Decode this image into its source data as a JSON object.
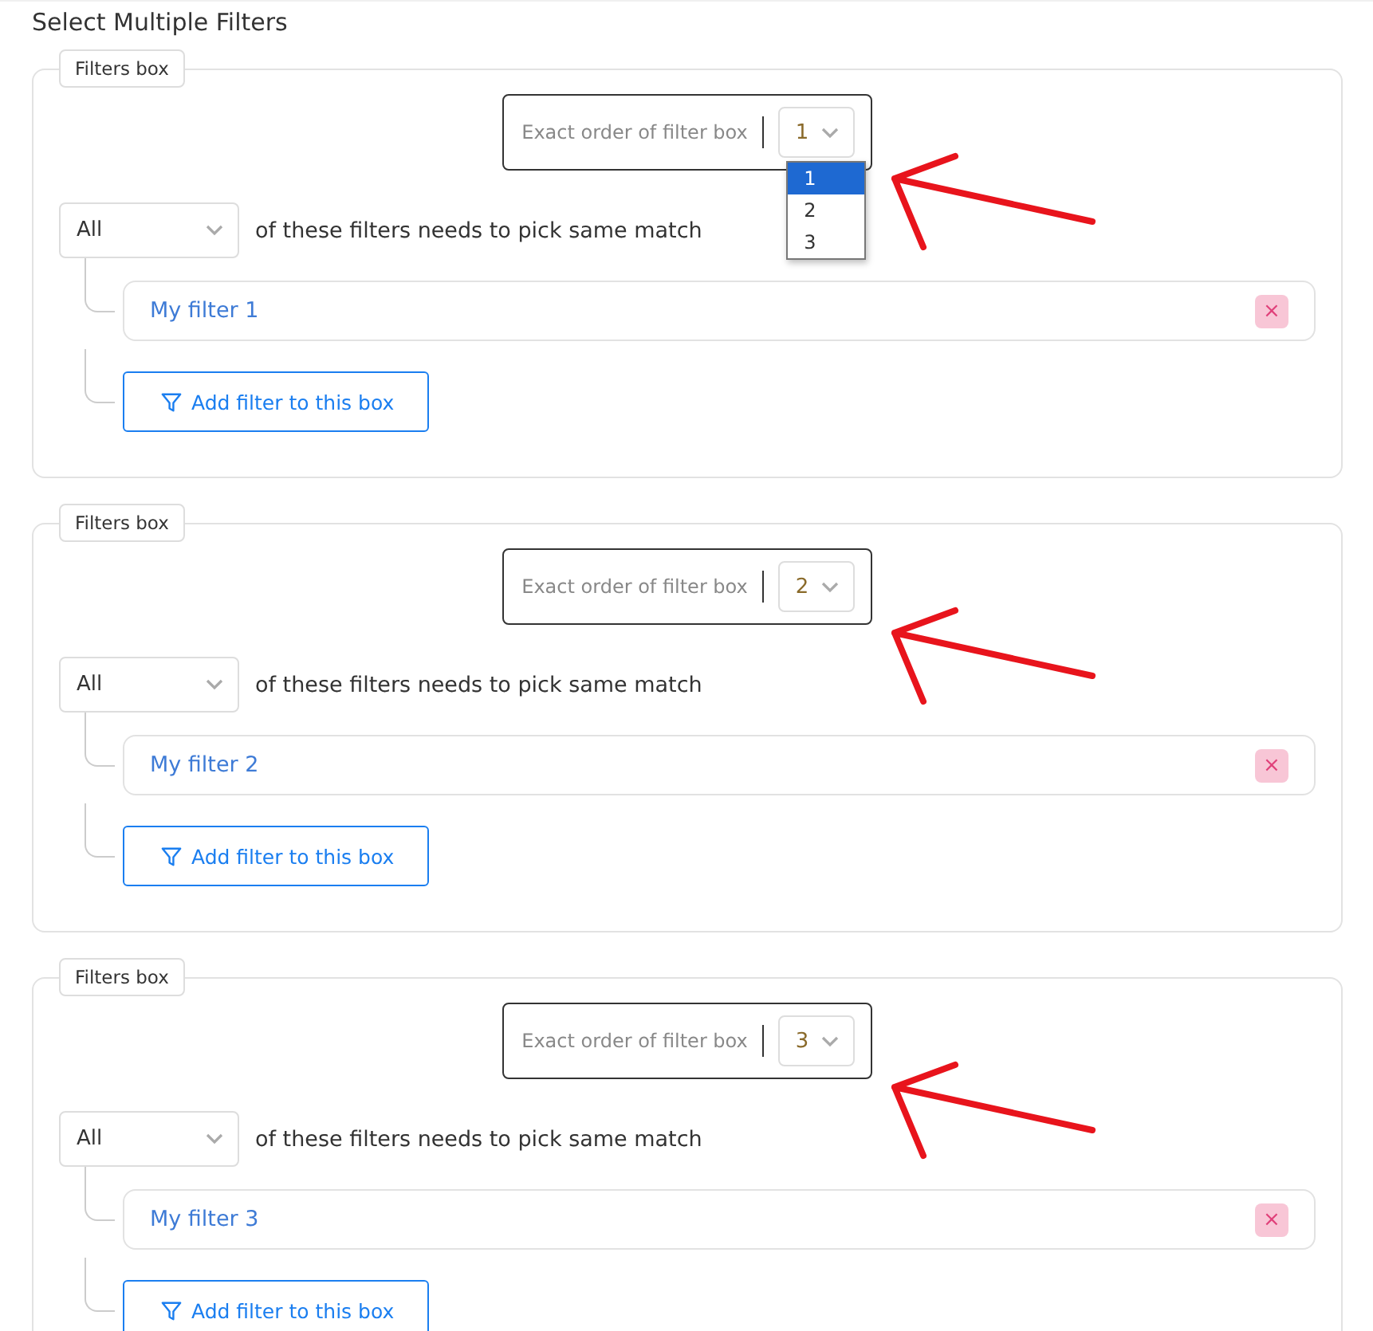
{
  "title": "Select Multiple Filters",
  "boxes": [
    {
      "legend": "Filters box",
      "order_label": "Exact order of filter box",
      "order_value": "1",
      "dropdown": {
        "open": true,
        "options": [
          {
            "label": "1",
            "selected": true
          },
          {
            "label": "2",
            "selected": false
          },
          {
            "label": "3",
            "selected": false
          }
        ]
      },
      "match_value": "All",
      "match_text": "of these filters needs to pick same match",
      "filters": [
        {
          "name": "My filter 1",
          "remove": "×"
        }
      ],
      "add_button": "Add filter to this box"
    },
    {
      "legend": "Filters box",
      "order_label": "Exact order of filter box",
      "order_value": "2",
      "match_value": "All",
      "match_text": "of these filters needs to pick same match",
      "filters": [
        {
          "name": "My filter 2",
          "remove": "×"
        }
      ],
      "add_button": "Add filter to this box"
    },
    {
      "legend": "Filters box",
      "order_label": "Exact order of filter box",
      "order_value": "3",
      "match_value": "All",
      "match_text": "of these filters needs to pick same match",
      "filters": [
        {
          "name": "My filter 3",
          "remove": "×"
        }
      ],
      "add_button": "Add filter to this box"
    }
  ]
}
